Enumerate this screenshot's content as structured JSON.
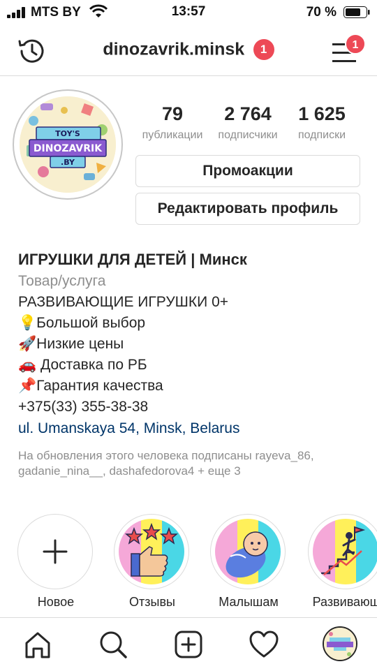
{
  "status_bar": {
    "carrier": "MTS BY",
    "time": "13:57",
    "battery": "70 %"
  },
  "header": {
    "username": "dinozavrik.minsk",
    "notification_badge": "1",
    "menu_badge": "1",
    "icons": [
      "history-icon",
      "menu-icon"
    ]
  },
  "avatar": {
    "logo_text": [
      "TOY'S",
      "DINOZAVRIK",
      ".BY"
    ]
  },
  "stats": [
    {
      "value": "79",
      "label": "публикации"
    },
    {
      "value": "2 764",
      "label": "подписчики"
    },
    {
      "value": "1 625",
      "label": "подписки"
    }
  ],
  "buttons": {
    "promo": "Промоакции",
    "edit_profile": "Редактировать профиль"
  },
  "bio": {
    "name": "ИГРУШКИ ДЛЯ ДЕТЕЙ | Минск",
    "category": "Товар/услуга",
    "lines": [
      "РАЗВИВАЮЩИЕ ИГРУШКИ 0+",
      "💡Большой выбор",
      "🚀Низкие цены",
      "🚗 Доставка по РБ",
      "📌Гарантия качества",
      "+375(33) 355-38-38"
    ],
    "address": "ul. Umanskaya 54, Minsk, Belarus",
    "followed_by": "На обновления этого человека подписаны rayeva_86, gadanie_nina__, dashafedorova4 + еще 3"
  },
  "highlights": [
    {
      "label": "Новое"
    },
    {
      "label": "Отзывы"
    },
    {
      "label": "Малышам"
    },
    {
      "label": "Развивающ"
    }
  ],
  "tabbar": {
    "icons": [
      "home-icon",
      "search-icon",
      "add-post-icon",
      "heart-icon",
      "profile-avatar"
    ]
  },
  "colors": {
    "badge": "#ed4956",
    "link": "#003569",
    "secondary_text": "#8e8e8e",
    "border": "#dbdbdb"
  }
}
